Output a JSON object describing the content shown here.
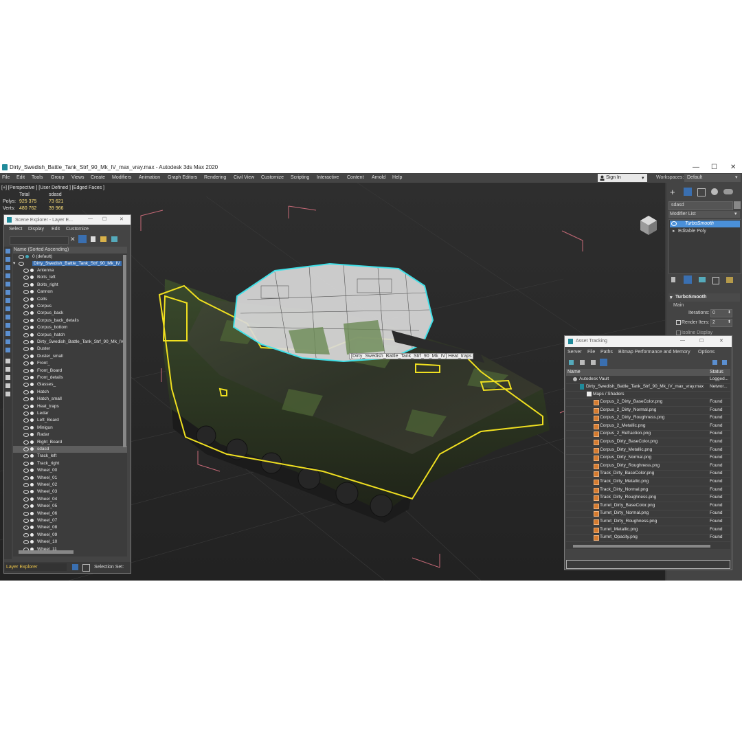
{
  "app": {
    "title": "Dirty_Swedish_Battle_Tank_Strf_90_Mk_IV_max_vray.max - Autodesk 3ds Max 2020"
  },
  "window_controls": {
    "minimize": "—",
    "maximize": "☐",
    "close": "✕"
  },
  "menu": [
    "File",
    "Edit",
    "Tools",
    "Group",
    "Views",
    "Create",
    "Modifiers",
    "Animation",
    "Graph Editors",
    "Rendering",
    "Civil View",
    "Customize",
    "Scripting",
    "Interactive",
    "Content",
    "Arnold",
    "Help"
  ],
  "signin": {
    "label": "Sign In"
  },
  "workspace": {
    "label": "Workspaces:",
    "value": "Default"
  },
  "viewport": {
    "label": "[+] [Perspective ] [User Defined ] [Edged Faces ]",
    "stats": {
      "total_label": "Total",
      "sel_label": "sdasd",
      "polys_label": "Polys:",
      "polys_total": "925 375",
      "polys_sel": "73 621",
      "verts_label": "Verts:",
      "verts_total": "480 762",
      "verts_sel": "39 966"
    },
    "tooltip": "[Dirty_Swedish_Battle_Tank_Strf_90_Mk_IV] Heat_traps"
  },
  "scene_explorer": {
    "title": "Scene Explorer - Layer E...",
    "menu": [
      "Select",
      "Display",
      "Edit",
      "Customize"
    ],
    "column": "Name (Sorted Ascending)",
    "layers": [
      "0 (default)",
      "Dirty_Swedish_Battle_Tank_Strf_90_Mk_IV"
    ],
    "items": [
      "Antenna",
      "Bolts_left",
      "Bolts_right",
      "Cannon",
      "Cells",
      "Corpus",
      "Corpus_back",
      "Corpus_back_details",
      "Corpus_bottom",
      "Corpus_hatch",
      "Dirty_Swedish_Battle_Tank_Strf_90_Mk_IV",
      "Duster",
      "Duster_small",
      "Front_",
      "Front_Board",
      "Front_details",
      "Glasses_",
      "Hatch",
      "Hatch_small",
      "Heat_traps",
      "Ledar",
      "Left_Board",
      "Minigun",
      "Radar",
      "Right_Board",
      "sdasd",
      "Track_left",
      "Track_right",
      "Wheel_00",
      "Wheel_01",
      "Wheel_02",
      "Wheel_03",
      "Wheel_04",
      "Wheel_05",
      "Wheel_06",
      "Wheel_07",
      "Wheel_08",
      "Wheel_09",
      "Wheel_10",
      "Wheel_11"
    ],
    "selected": "sdasd",
    "footer_left": "Layer Explorer",
    "footer_right": "Selection Set:"
  },
  "command_panel": {
    "name_field": "sdasd",
    "modifier_list": "Modifier List",
    "stack": [
      "TurboSmooth",
      "Editable Poly"
    ],
    "rollout": "TurboSmooth",
    "main": "Main",
    "iterations_label": "Iterations:",
    "iterations": "0",
    "render_iters_label": "Render Iters:",
    "render_iters": "2",
    "isoline": "Isoline Display"
  },
  "asset_tracking": {
    "title": "Asset Tracking",
    "menu": [
      "Server",
      "File",
      "Paths",
      "Bitmap Performance and Memory",
      "Options"
    ],
    "col_name": "Name",
    "col_status": "Status",
    "vault": {
      "name": "Autodesk Vault",
      "status": "Logged..."
    },
    "file": {
      "name": "Dirty_Swedish_Battle_Tank_Strf_90_Mk_IV_max_vray.max",
      "status": "Networ..."
    },
    "maps": "Maps / Shaders",
    "assets": [
      {
        "name": "Corpus_2_Dirty_BaseColor.png",
        "status": "Found"
      },
      {
        "name": "Corpus_2_Dirty_Normal.png",
        "status": "Found"
      },
      {
        "name": "Corpus_2_Dirty_Roughness.png",
        "status": "Found"
      },
      {
        "name": "Corpus_2_Metallic.png",
        "status": "Found"
      },
      {
        "name": "Corpus_2_Refraction.png",
        "status": "Found"
      },
      {
        "name": "Corpus_Dirty_BaseColor.png",
        "status": "Found"
      },
      {
        "name": "Corpus_Dirty_Metallic.png",
        "status": "Found"
      },
      {
        "name": "Corpus_Dirty_Normal.png",
        "status": "Found"
      },
      {
        "name": "Corpus_Dirty_Roughness.png",
        "status": "Found"
      },
      {
        "name": "Track_Dirty_BaseColor.png",
        "status": "Found"
      },
      {
        "name": "Track_Dirty_Metallic.png",
        "status": "Found"
      },
      {
        "name": "Track_Dirty_Normal.png",
        "status": "Found"
      },
      {
        "name": "Track_Dirty_Roughness.png",
        "status": "Found"
      },
      {
        "name": "Turret_Dirty_BaseColor.png",
        "status": "Found"
      },
      {
        "name": "Turret_Dirty_Normal.png",
        "status": "Found"
      },
      {
        "name": "Turret_Dirty_Roughness.png",
        "status": "Found"
      },
      {
        "name": "Turret_Metallic.png",
        "status": "Found"
      },
      {
        "name": "Turret_Opacity.png",
        "status": "Found"
      }
    ]
  },
  "colors": {
    "selection_outline": "#f0e020",
    "turret_outline": "#40e0e8",
    "bbox": "#c86a78",
    "accent": "#4a90d9"
  }
}
